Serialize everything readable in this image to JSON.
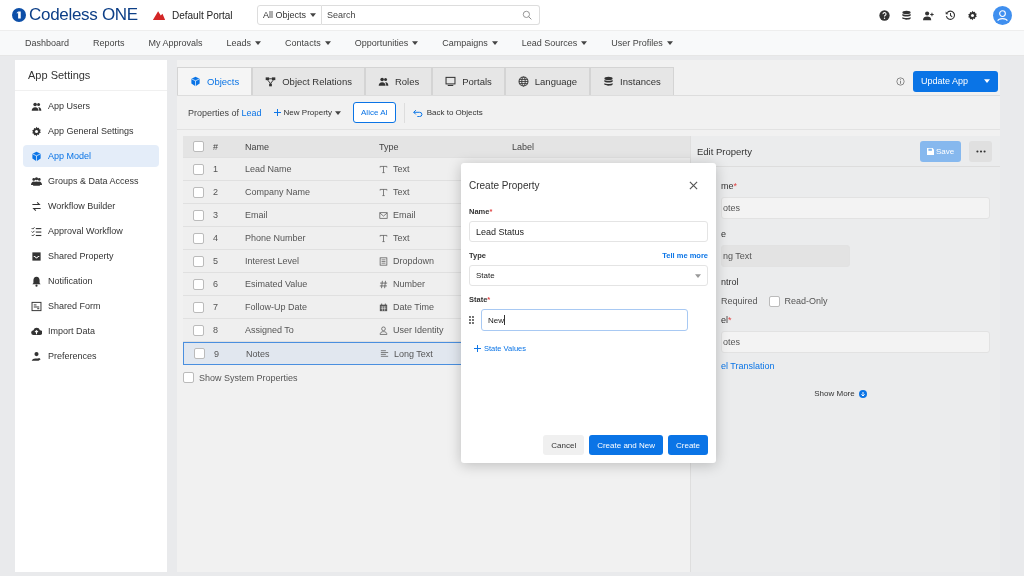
{
  "header": {
    "logo": "Codeless ONE",
    "portal": "Default Portal",
    "scope": "All Objects",
    "search": {
      "placeholder": "Search"
    }
  },
  "nav": [
    {
      "label": "Dashboard",
      "dropdown": false
    },
    {
      "label": "Reports",
      "dropdown": false
    },
    {
      "label": "My Approvals",
      "dropdown": false
    },
    {
      "label": "Leads",
      "dropdown": true
    },
    {
      "label": "Contacts",
      "dropdown": true
    },
    {
      "label": "Opportunities",
      "dropdown": true
    },
    {
      "label": "Campaigns",
      "dropdown": true
    },
    {
      "label": "Lead Sources",
      "dropdown": true
    },
    {
      "label": "User Profiles",
      "dropdown": true
    }
  ],
  "sidebar": {
    "title": "App Settings",
    "items": [
      {
        "label": "App Users",
        "selected": false
      },
      {
        "label": "App General Settings",
        "selected": false
      },
      {
        "label": "App Model",
        "selected": true
      },
      {
        "label": "Groups & Data Access",
        "selected": false
      },
      {
        "label": "Workflow Builder",
        "selected": false
      },
      {
        "label": "Approval Workflow",
        "selected": false
      },
      {
        "label": "Shared Property",
        "selected": false
      },
      {
        "label": "Notification",
        "selected": false
      },
      {
        "label": "Shared Form",
        "selected": false
      },
      {
        "label": "Import Data",
        "selected": false
      },
      {
        "label": "Preferences",
        "selected": false
      }
    ]
  },
  "tabs": [
    {
      "label": "Objects",
      "selected": true
    },
    {
      "label": "Object Relations",
      "selected": false
    },
    {
      "label": "Roles",
      "selected": false
    },
    {
      "label": "Portals",
      "selected": false
    },
    {
      "label": "Language",
      "selected": false
    },
    {
      "label": "Instances",
      "selected": false
    }
  ],
  "update_button": "Update App",
  "toolbar": {
    "prefix": "Properties of",
    "object": "Lead",
    "new_button": "New Property",
    "ai_button": "Alice AI",
    "back_link": "Back to Objects"
  },
  "table": {
    "columns": [
      "#",
      "Name",
      "Type",
      "Label"
    ],
    "all_checked": false,
    "rows": [
      {
        "number": "1",
        "name": "Lead Name",
        "type": "Text",
        "kind": "text",
        "selected": false
      },
      {
        "number": "2",
        "name": "Company Name",
        "type": "Text",
        "kind": "text",
        "selected": false
      },
      {
        "number": "3",
        "name": "Email",
        "type": "Email",
        "kind": "email",
        "selected": false
      },
      {
        "number": "4",
        "name": "Phone Number",
        "type": "Text",
        "kind": "text",
        "selected": false
      },
      {
        "number": "5",
        "name": "Interest Level",
        "type": "Dropdown",
        "kind": "list",
        "selected": false
      },
      {
        "number": "6",
        "name": "Esimated Value",
        "type": "Number",
        "kind": "number",
        "selected": false
      },
      {
        "number": "7",
        "name": "Follow-Up Date",
        "type": "Date Time",
        "kind": "datetime",
        "selected": false
      },
      {
        "number": "8",
        "name": "Assigned To",
        "type": "User Identity",
        "kind": "user",
        "selected": false
      },
      {
        "number": "9",
        "name": "Notes",
        "type": "Long Text",
        "kind": "longtext",
        "selected": true
      }
    ]
  },
  "show_system": {
    "label": "Show System Properties",
    "checked": false
  },
  "edit_panel": {
    "title": "Edit Property",
    "save": "Save",
    "fields": [
      {
        "kind": "input",
        "label": "me",
        "mark": "*",
        "value": "otes"
      },
      {
        "kind": "readonly",
        "label": "e",
        "value": "ng Text"
      },
      {
        "kind": "checks",
        "label": "ntrol",
        "first": "Required",
        "second": {
          "label": "Read-Only",
          "checked": false
        }
      },
      {
        "kind": "input",
        "label": "el",
        "mark": "*",
        "value": "otes"
      }
    ],
    "link": "el Translation",
    "show_more": "Show More"
  },
  "dialog": {
    "title": "Create Property",
    "name_label": "Name",
    "name_mark": "*",
    "name_value": "Lead Status",
    "type_label": "Type",
    "help_link": "Tell me more",
    "type_value": "State",
    "state_label": "State",
    "state_mark": "*",
    "state_value": "New",
    "add_link": "State Values",
    "buttons": [
      {
        "label": "Cancel",
        "kind": "secondary"
      },
      {
        "label": "Create and New",
        "kind": "primary"
      },
      {
        "label": "Create",
        "kind": "primary"
      }
    ]
  }
}
